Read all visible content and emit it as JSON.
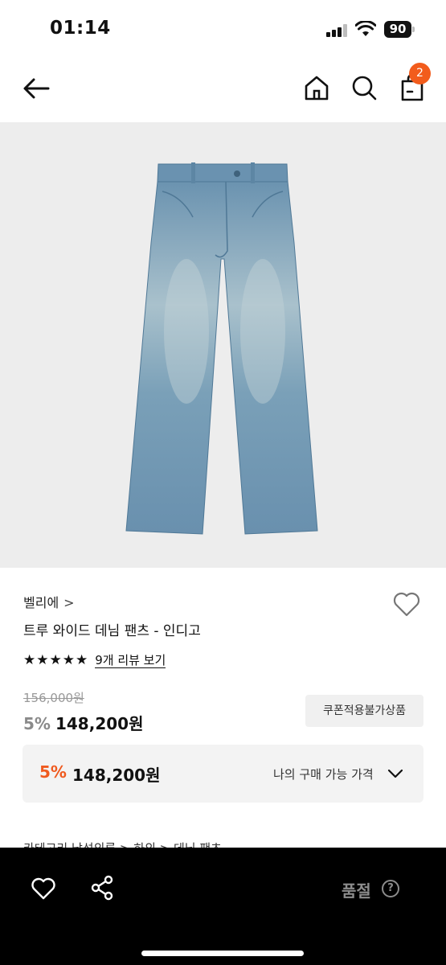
{
  "status_bar": {
    "time": "01:14",
    "battery": "90",
    "icons": [
      "signal-icon",
      "wifi-icon",
      "battery-icon"
    ]
  },
  "nav": {
    "icons": [
      "back-arrow-icon",
      "home-icon",
      "search-icon",
      "cart-icon"
    ],
    "cart_count": "2",
    "badge_color": "#f25c1c"
  },
  "product": {
    "image": "light-blue-wide-leg-denim-jeans",
    "brand": "벨리에",
    "brand_chevron": ">",
    "name": "트루 와이드 데님 팬츠 - 인디고",
    "rating_stars": "★★★★★",
    "rating": 5,
    "review_link": "9개 리뷰 보기",
    "original_price": "156,000원",
    "discount_rate": "5%",
    "sale_price": "148,200원",
    "coupon_badge": "쿠폰적용불가상품"
  },
  "my_price": {
    "discount_rate": "5%",
    "price": "148,200원",
    "label": "나의 구매 가능 가격",
    "accent_color": "#ef5a1f"
  },
  "category": {
    "text": "카테고리 남성의류 > 하의 > 데님 팬츠"
  },
  "bottom_bar": {
    "icons": [
      "heart-icon",
      "share-icon",
      "help-icon"
    ],
    "status": "품절",
    "help_glyph": "?"
  }
}
